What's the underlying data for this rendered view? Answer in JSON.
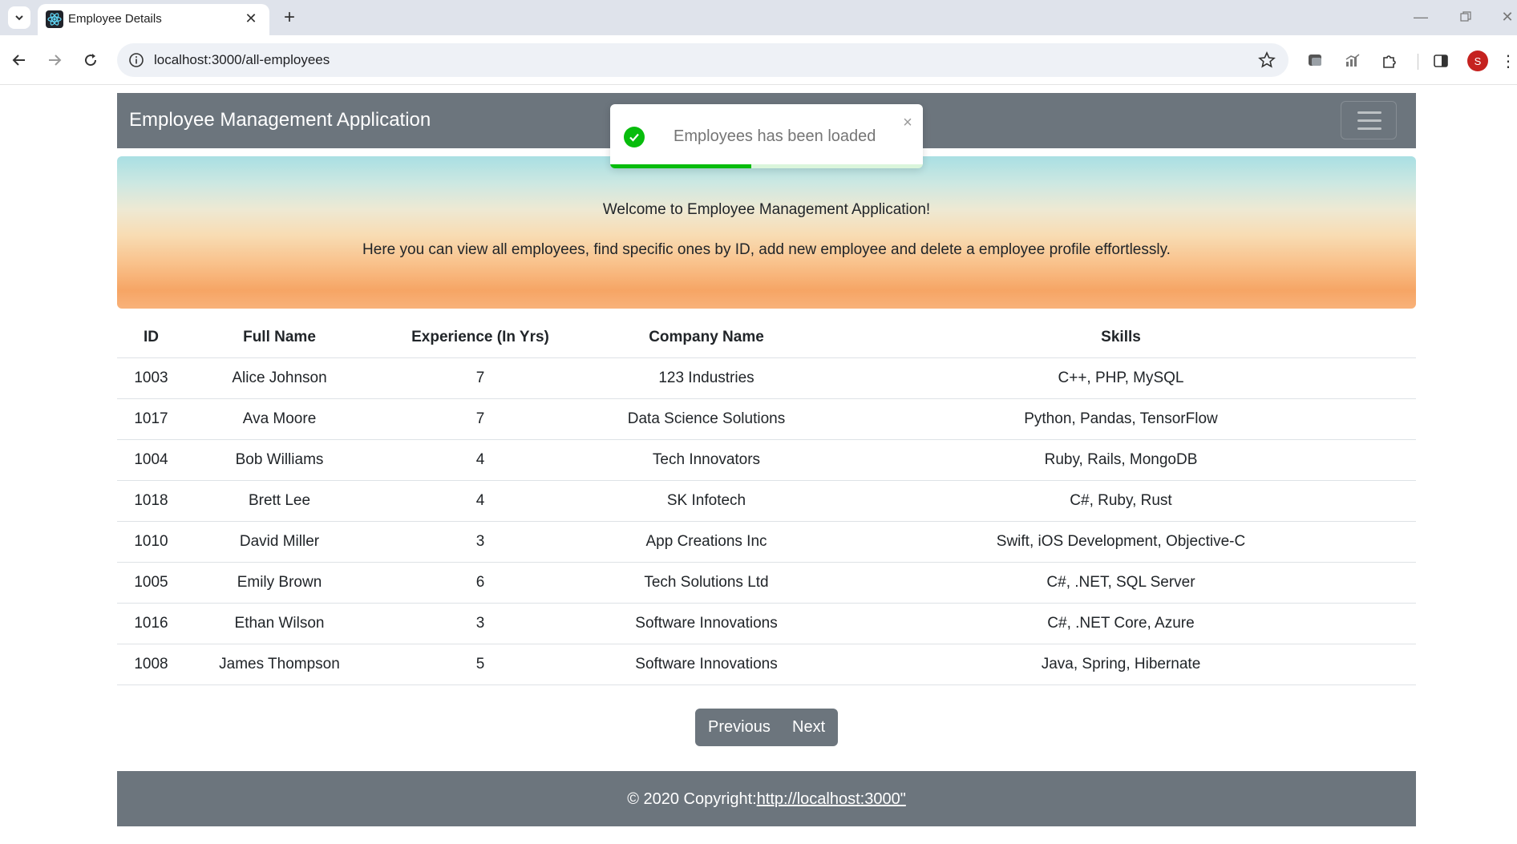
{
  "browser": {
    "tab_title": "Employee Details",
    "url": "localhost:3000/all-employees",
    "profile_initial": "S"
  },
  "navbar": {
    "brand": "Employee Management Application"
  },
  "toast": {
    "message": "Employees has been loaded",
    "progress": 0.45,
    "color": "#07bc0c"
  },
  "hero": {
    "line1": "Welcome to Employee Management Application!",
    "line2": "Here you can view all employees, find specific ones by ID, add new employee and delete a employee profile effortlessly."
  },
  "table": {
    "headers": [
      "ID",
      "Full Name",
      "Experience (In Yrs)",
      "Company Name",
      "Skills"
    ],
    "rows": [
      [
        "1003",
        "Alice Johnson",
        "7",
        "123 Industries",
        "C++, PHP, MySQL"
      ],
      [
        "1017",
        "Ava Moore",
        "7",
        "Data Science Solutions",
        "Python, Pandas, TensorFlow"
      ],
      [
        "1004",
        "Bob Williams",
        "4",
        "Tech Innovators",
        "Ruby, Rails, MongoDB"
      ],
      [
        "1018",
        "Brett Lee",
        "4",
        "SK Infotech",
        "C#, Ruby, Rust"
      ],
      [
        "1010",
        "David Miller",
        "3",
        "App Creations Inc",
        "Swift, iOS Development, Objective-C"
      ],
      [
        "1005",
        "Emily Brown",
        "6",
        "Tech Solutions Ltd",
        "C#, .NET, SQL Server"
      ],
      [
        "1016",
        "Ethan Wilson",
        "3",
        "Software Innovations",
        "C#, .NET Core, Azure"
      ],
      [
        "1008",
        "James Thompson",
        "5",
        "Software Innovations",
        "Java, Spring, Hibernate"
      ]
    ]
  },
  "pagination": {
    "previous": "Previous",
    "next": "Next"
  },
  "footer": {
    "text": "© 2020 Copyright:",
    "link": "http://localhost:3000\""
  },
  "colors": {
    "navbar": "#6c757d",
    "toast_success": "#07bc0c"
  }
}
